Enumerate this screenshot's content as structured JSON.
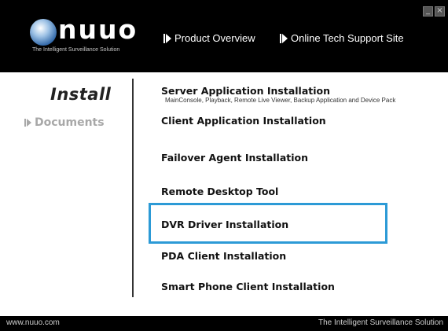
{
  "header": {
    "logo_text": "nuuo",
    "tagline": "The Intelligent Surveillance Solution",
    "nav": [
      {
        "label": "Product Overview"
      },
      {
        "label": "Online Tech Support Site"
      }
    ],
    "minimize_glyph": "_",
    "close_glyph": "×"
  },
  "sidebar": {
    "install_label": "Install",
    "documents_label": "Documents"
  },
  "main": {
    "items": [
      {
        "label": "Server Application Installation",
        "sub": "MainConsole, Playback, Remote Live Viewer, Backup Application and Device Pack"
      },
      {
        "label": "Client Application Installation"
      },
      {
        "label": "Failover Agent Installation"
      },
      {
        "label": "Remote Desktop Tool"
      },
      {
        "label": "DVR Driver Installation"
      },
      {
        "label": "PDA Client Installation"
      },
      {
        "label": "Smart Phone Client Installation"
      }
    ]
  },
  "footer": {
    "left": "www.nuuo.com",
    "right": "The Intelligent Surveillance Solution"
  },
  "colors": {
    "highlight": "#2c9ad6",
    "header_bg": "#000000"
  }
}
